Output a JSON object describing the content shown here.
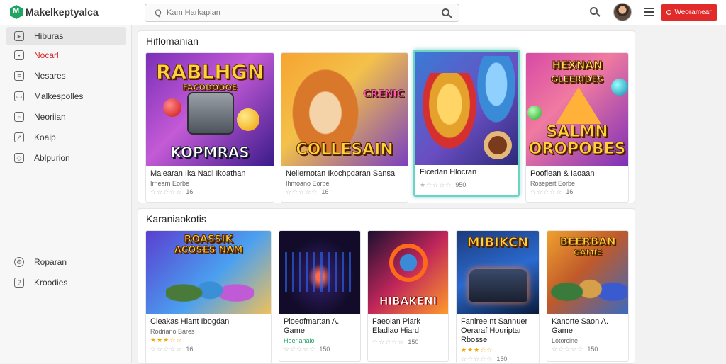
{
  "app": {
    "name": "Makelkeptyalca"
  },
  "search": {
    "placeholder": "Kam Harkapian"
  },
  "header": {
    "button_label": "Weoramear"
  },
  "sidebar": {
    "items": [
      {
        "label": "Hiburas",
        "icon": "store-icon"
      },
      {
        "label": "Nocarl",
        "icon": "news-icon"
      },
      {
        "label": "Nesares",
        "icon": "list-icon"
      },
      {
        "label": "Malkespolles",
        "icon": "library-icon"
      },
      {
        "label": "Neoriian",
        "icon": "clock-icon"
      },
      {
        "label": "Koaip",
        "icon": "box-icon"
      },
      {
        "label": "Ablpurion",
        "icon": "tag-icon"
      }
    ],
    "bottom_items": [
      {
        "label": "Roparan",
        "icon": "gear-icon"
      },
      {
        "label": "Kroodies",
        "icon": "help-icon"
      }
    ]
  },
  "sections": [
    {
      "title": "Hiflomanian",
      "cards": [
        {
          "art_title": "RABLHGN",
          "art_sub": "FACODODOE",
          "art_bottom": "KOPMRAS",
          "title": "Malearan Ika Nadl Ikoathan",
          "sub": "Irnearn Eorbe",
          "rating": "☆☆☆☆☆",
          "count": "16"
        },
        {
          "art_title": "CRENIC",
          "art_sub": "",
          "art_bottom": "COLLESAIN",
          "title": "Nellernotan Ikochpdaran Sansa",
          "sub": "Ihmoano Eorbe",
          "rating": "☆☆☆☆☆",
          "count": "16"
        },
        {
          "art_title": "",
          "art_sub": "",
          "art_bottom": "",
          "title": "Ficedan Hlocran",
          "sub": "",
          "rating": "★☆☆☆☆",
          "count": "950"
        },
        {
          "art_title": "HEXNAN",
          "art_sub": "GLEERIDES",
          "art_bottom": "SALMN OROPOBES",
          "title": "Poofiean & Iaoaan",
          "sub": "Rosepert Eorbe",
          "rating": "☆☆☆☆☆",
          "count": "16"
        }
      ]
    },
    {
      "title": "Karaniaokotis",
      "cards": [
        {
          "art_title": "ROASSIK",
          "art_sub": "ACOSES NAM",
          "art_bottom": "",
          "title": "Cleakas Hiant Ibogdan",
          "sub": "Rodriano Bares",
          "rating": "★★★☆☆",
          "rating2": "☆☆☆☆☆",
          "count": "16"
        },
        {
          "art_title": "",
          "art_sub": "",
          "art_bottom": "",
          "title": "Ploeofmartan A. Game",
          "sub": "Hoerianalo",
          "rating": "☆☆☆☆☆",
          "count": "150",
          "sub_green": true
        },
        {
          "art_title": "",
          "art_sub": "",
          "art_bottom": "HIBAKENI",
          "title": "Faeolan Plark Eladlao Hiard",
          "sub": "",
          "rating": "☆☆☆☆☆",
          "count": "150"
        },
        {
          "art_title": "MIBIKCN",
          "art_sub": "",
          "art_bottom": "",
          "title": "Fanlree nt Sannuer Oeraraf Houriptar Rbosse",
          "sub": "",
          "rating": "★★★☆☆",
          "rating2": "☆☆☆☆☆",
          "count": "150"
        },
        {
          "art_title": "BEERBAN",
          "art_sub": "GAMIE",
          "art_bottom": "",
          "title": "Kanorte Saon A. Game",
          "sub": "Lotorcine",
          "rating": "☆☆☆☆☆",
          "count": "150"
        }
      ]
    }
  ],
  "colors": {
    "accent": "#e12a2a",
    "brand": "#1fa463",
    "selection": "#6cd3c7"
  }
}
